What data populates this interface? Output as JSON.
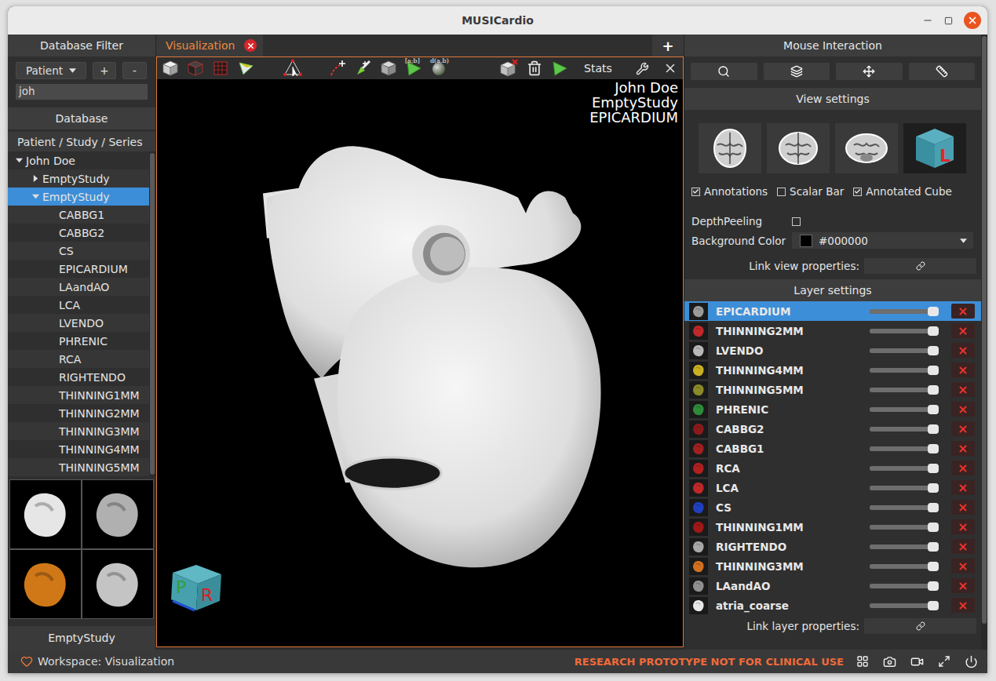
{
  "window": {
    "title": "MUSICardio"
  },
  "database_filter": {
    "title": "Database Filter",
    "filter_field": "Patient",
    "add_button": "+",
    "remove_button": "-",
    "search_value": "joh"
  },
  "database": {
    "title": "Database",
    "column": "Patient / Study / Series",
    "tree": [
      {
        "label": "John Doe",
        "level": 0,
        "expandable": true,
        "expanded": true,
        "selected": false
      },
      {
        "label": "EmptyStudy",
        "level": 1,
        "expandable": true,
        "expanded": false,
        "selected": false
      },
      {
        "label": "EmptyStudy",
        "level": 1,
        "expandable": true,
        "expanded": true,
        "selected": true
      },
      {
        "label": "CABBG1",
        "level": 2,
        "expandable": false,
        "expanded": false,
        "selected": false
      },
      {
        "label": "CABBG2",
        "level": 2,
        "expandable": false,
        "expanded": false,
        "selected": false
      },
      {
        "label": "CS",
        "level": 2,
        "expandable": false,
        "expanded": false,
        "selected": false
      },
      {
        "label": "EPICARDIUM",
        "level": 2,
        "expandable": false,
        "expanded": false,
        "selected": false
      },
      {
        "label": "LAandAO",
        "level": 2,
        "expandable": false,
        "expanded": false,
        "selected": false
      },
      {
        "label": "LCA",
        "level": 2,
        "expandable": false,
        "expanded": false,
        "selected": false
      },
      {
        "label": "LVENDO",
        "level": 2,
        "expandable": false,
        "expanded": false,
        "selected": false
      },
      {
        "label": "PHRENIC",
        "level": 2,
        "expandable": false,
        "expanded": false,
        "selected": false
      },
      {
        "label": "RCA",
        "level": 2,
        "expandable": false,
        "expanded": false,
        "selected": false
      },
      {
        "label": "RIGHTENDO",
        "level": 2,
        "expandable": false,
        "expanded": false,
        "selected": false
      },
      {
        "label": "THINNING1MM",
        "level": 2,
        "expandable": false,
        "expanded": false,
        "selected": false
      },
      {
        "label": "THINNING2MM",
        "level": 2,
        "expandable": false,
        "expanded": false,
        "selected": false
      },
      {
        "label": "THINNING3MM",
        "level": 2,
        "expandable": false,
        "expanded": false,
        "selected": false
      },
      {
        "label": "THINNING4MM",
        "level": 2,
        "expandable": false,
        "expanded": false,
        "selected": false
      },
      {
        "label": "THINNING5MM",
        "level": 2,
        "expandable": false,
        "expanded": false,
        "selected": false
      }
    ],
    "thumbnails": [
      {
        "color": "#e6e6e6"
      },
      {
        "color": "#b0b0b0"
      },
      {
        "color": "#d07818"
      },
      {
        "color": "#c4c4c4"
      }
    ],
    "footer_label": "EmptyStudy"
  },
  "tabs": [
    {
      "label": "Visualization",
      "selected": true
    }
  ],
  "new_tab_button": "+",
  "viewer": {
    "tools_left": [
      {
        "kind": "view-cube",
        "label": ""
      },
      {
        "kind": "view-cube-dark",
        "label": ""
      },
      {
        "kind": "grid-cube",
        "label": ""
      },
      {
        "kind": "mesh-triangle",
        "label": ""
      }
    ],
    "tools_middle": [
      {
        "kind": "select-arrow",
        "label": ""
      }
    ],
    "tools_edit": [
      {
        "kind": "curve-add",
        "label": ""
      },
      {
        "kind": "paint-brush",
        "label": ""
      },
      {
        "kind": "eraser",
        "label": ""
      },
      {
        "kind": "label-triangle",
        "label": "[a;b]"
      },
      {
        "kind": "distance-sphere",
        "label": "d(a,b)"
      }
    ],
    "tools_right": [
      {
        "kind": "clear-cube",
        "label": ""
      },
      {
        "kind": "trash",
        "label": ""
      },
      {
        "kind": "green-triangle",
        "label": ""
      }
    ],
    "stats_button": "Stats",
    "overlay": [
      "John Doe",
      "EmptyStudy",
      "EPICARDIUM"
    ],
    "orientation_cube": [
      "P",
      "R"
    ]
  },
  "mouse_interaction": {
    "title": "Mouse Interaction",
    "buttons": [
      {
        "kind": "zoom"
      },
      {
        "kind": "layers"
      },
      {
        "kind": "move"
      },
      {
        "kind": "ruler"
      }
    ]
  },
  "view_settings": {
    "title": "View settings",
    "views": [
      {
        "kind": "axial",
        "selected": false
      },
      {
        "kind": "coronal",
        "selected": false
      },
      {
        "kind": "sagittal",
        "selected": false
      },
      {
        "kind": "cube",
        "selected": true
      }
    ],
    "cube_label": "L",
    "options": [
      {
        "label": "Annotations",
        "checked": true
      },
      {
        "label": "Scalar Bar",
        "checked": false
      },
      {
        "label": "Annotated Cube",
        "checked": true
      }
    ],
    "depth_peeling": {
      "label": "DepthPeeling",
      "checked": false
    },
    "background_color": {
      "label": "Background Color",
      "value": "#000000",
      "color": "#000000"
    },
    "link_label": "Link view properties:"
  },
  "layer_settings": {
    "title": "Layer settings",
    "layers": [
      {
        "name": "EPICARDIUM",
        "selected": true,
        "level": 1,
        "color": "#9a9a9a"
      },
      {
        "name": "THINNING2MM",
        "selected": false,
        "level": 1,
        "color": "#c0282a"
      },
      {
        "name": "LVENDO",
        "selected": false,
        "level": 1,
        "color": "#b8b8b8"
      },
      {
        "name": "THINNING4MM",
        "selected": false,
        "level": 1,
        "color": "#c8b020"
      },
      {
        "name": "THINNING5MM",
        "selected": false,
        "level": 1,
        "color": "#8a8a2a"
      },
      {
        "name": "PHRENIC",
        "selected": false,
        "level": 1,
        "color": "#2e8b3a"
      },
      {
        "name": "CABBG2",
        "selected": false,
        "level": 1,
        "color": "#8a1a1a"
      },
      {
        "name": "CABBG1",
        "selected": false,
        "level": 1,
        "color": "#a02020"
      },
      {
        "name": "RCA",
        "selected": false,
        "level": 1,
        "color": "#b02020"
      },
      {
        "name": "LCA",
        "selected": false,
        "level": 1,
        "color": "#c02828"
      },
      {
        "name": "CS",
        "selected": false,
        "level": 1,
        "color": "#2040c0"
      },
      {
        "name": "THINNING1MM",
        "selected": false,
        "level": 1,
        "color": "#a01818"
      },
      {
        "name": "RIGHTENDO",
        "selected": false,
        "level": 1,
        "color": "#a8a8a8"
      },
      {
        "name": "THINNING3MM",
        "selected": false,
        "level": 1,
        "color": "#d07020"
      },
      {
        "name": "LAandAO",
        "selected": false,
        "level": 1,
        "color": "#909090"
      },
      {
        "name": "atria_coarse",
        "selected": false,
        "level": 1,
        "color": "#e8e8e8"
      }
    ],
    "link_label": "Link layer properties:"
  },
  "status_bar": {
    "workspace": "Workspace: Visualization",
    "warning": "RESEARCH PROTOTYPE NOT FOR CLINICAL USE"
  }
}
